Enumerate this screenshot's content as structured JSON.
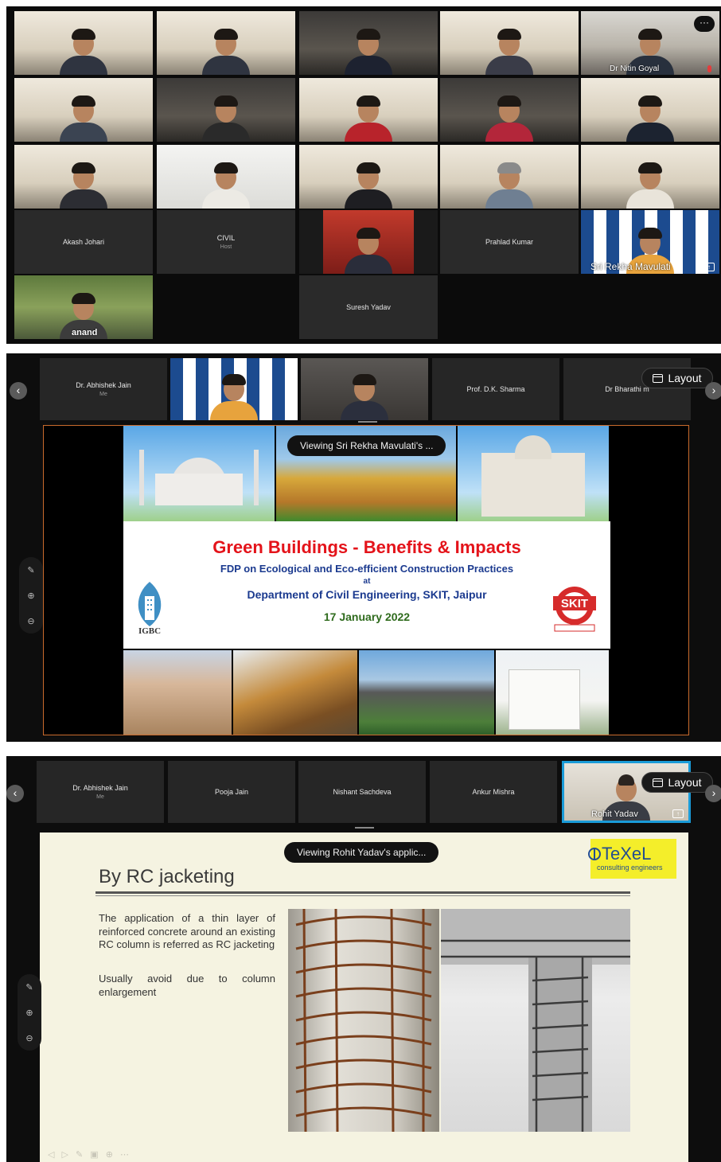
{
  "gallery": {
    "tiles": [
      {
        "name": "",
        "sub": ""
      },
      {
        "name": "",
        "sub": ""
      },
      {
        "name": "",
        "sub": ""
      },
      {
        "name": "",
        "sub": ""
      },
      {
        "name": "Dr Nitin Goyal",
        "sub": ""
      },
      {
        "name": "",
        "sub": ""
      },
      {
        "name": "",
        "sub": ""
      },
      {
        "name": "",
        "sub": ""
      },
      {
        "name": "",
        "sub": ""
      },
      {
        "name": "",
        "sub": ""
      },
      {
        "name": "",
        "sub": ""
      },
      {
        "name": "",
        "sub": ""
      },
      {
        "name": "",
        "sub": ""
      },
      {
        "name": "",
        "sub": ""
      },
      {
        "name": "",
        "sub": ""
      },
      {
        "name": "Akash Johari",
        "sub": ""
      },
      {
        "name": "CIVIL",
        "sub": "Host"
      },
      {
        "name": "",
        "sub": ""
      },
      {
        "name": "Prahlad Kumar",
        "sub": ""
      },
      {
        "name": "Sri Rekha Mavulati",
        "sub": ""
      },
      {
        "name": "anand",
        "sub": ""
      },
      {
        "name": "Suresh Yadav",
        "sub": ""
      }
    ],
    "more_label": "···"
  },
  "share1": {
    "strip": [
      {
        "name": "Dr. Abhishek Jain",
        "sub": "Me"
      },
      {
        "name": "",
        "sub": ""
      },
      {
        "name": "",
        "sub": ""
      },
      {
        "name": "Prof. D.K. Sharma",
        "sub": ""
      },
      {
        "name": "Dr Bharathi m",
        "sub": ""
      }
    ],
    "layout_label": "Layout",
    "viewing": "Viewing Sri Rekha Mavulati's ...",
    "slide": {
      "title": "Green Buildings - Benefits & Impacts",
      "subtitle": "FDP on Ecological and Eco-efficient Construction Practices",
      "at": "at",
      "department": "Department of Civil Engineering, SKIT, Jaipur",
      "date": "17 January 2022",
      "left_logo": "IGBC",
      "right_logo": "SKIT"
    }
  },
  "share2": {
    "strip": [
      {
        "name": "Dr. Abhishek Jain",
        "sub": "Me"
      },
      {
        "name": "Pooja Jain",
        "sub": ""
      },
      {
        "name": "Nishant Sachdeva",
        "sub": ""
      },
      {
        "name": "Ankur Mishra",
        "sub": ""
      },
      {
        "name": "Rohit Yadav",
        "sub": ""
      }
    ],
    "layout_label": "Layout",
    "viewing": "Viewing Rohit Yadav's applic...",
    "slide": {
      "title": "By RC jacketing",
      "para1": "The application of a thin layer of reinforced concrete around an existing RC column is referred as RC jacketing",
      "para2": "Usually avoid due to column enlargement",
      "logo_name": "TeXeL",
      "logo_tag": "consulting engineers"
    }
  },
  "colors": {
    "accent_border": "#c96a2c",
    "active_speaker": "#1a9bd8",
    "slide_title_red": "#e4131a",
    "slide_sub_blue": "#1b3a8f",
    "slide_date_green": "#2f6b1d"
  }
}
